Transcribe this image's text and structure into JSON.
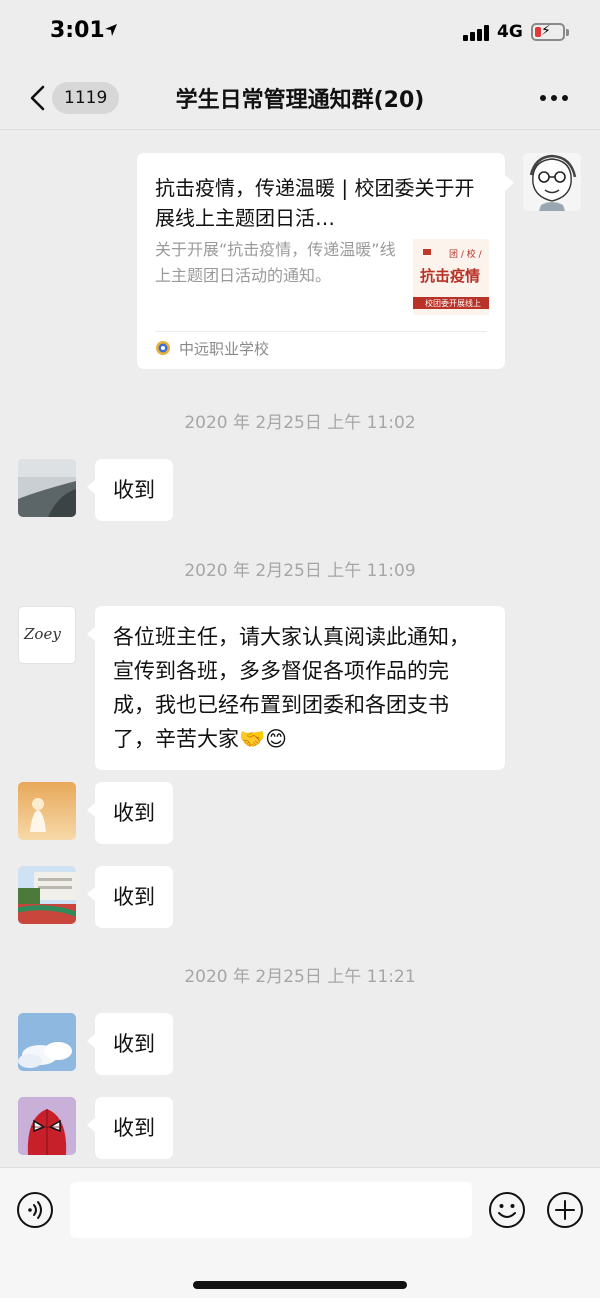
{
  "status_bar": {
    "time": "3:01",
    "network": "4G",
    "battery_color": "#e53935"
  },
  "nav": {
    "unread_count": "1119",
    "title": "学生日常管理通知群(20)"
  },
  "link_card": {
    "title": "抗击疫情，传递温暖 | 校团委关于开展线上主题团日活…",
    "description": "关于开展“抗击疫情，传递温暖”线上主题团日活动的通知。",
    "thumb_header": "团 / 校 /",
    "thumb_title": "抗击疫情",
    "thumb_footer": "校团委开展线上",
    "source": "中远职业学校"
  },
  "messages": [
    {
      "timestamp": "2020 年 2月25日 上午 11:02",
      "text": "收到",
      "avatar": "coast-avatar"
    },
    {
      "timestamp": "2020 年 2月25日 上午 11:09",
      "text": "各位班主任，请大家认真阅读此通知，宣传到各班，多多督促各项作品的完成，我也已经布置到团委和各团支书了，辛苦大家🤝😊",
      "avatar": "zoey-avatar",
      "avatar_text": "Zoey"
    },
    {
      "text": "收到",
      "avatar": "sunset-girl-avatar"
    },
    {
      "text": "收到",
      "avatar": "school-campus-avatar"
    },
    {
      "timestamp": "2020 年 2月25日 上午 11:21",
      "text": "收到",
      "avatar": "clouds-avatar"
    },
    {
      "text": "收到",
      "avatar": "spiderman-avatar"
    }
  ],
  "input": {
    "placeholder": ""
  },
  "colors": {
    "background": "#ededed",
    "bubble": "#ffffff",
    "timestamp": "#a6a6a6"
  }
}
